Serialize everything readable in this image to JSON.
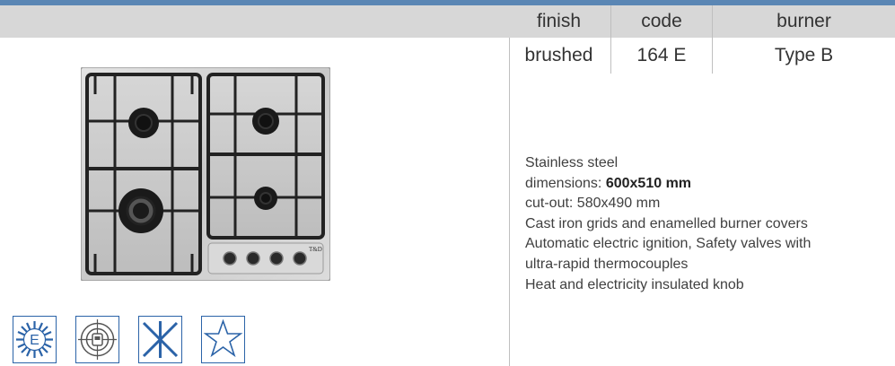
{
  "specs": {
    "headers": [
      "finish",
      "code",
      "burner"
    ],
    "values": [
      "brushed",
      "164 E",
      "Type B"
    ]
  },
  "description": {
    "material": "Stainless steel",
    "dimensions_label": "dimensions: ",
    "dimensions_value": "600x510 mm",
    "cutout": "cut-out: 580x490 mm",
    "grids": "Cast iron grids and enamelled burner covers",
    "ignition_1": "Automatic electric ignition, Safety valves with",
    "ignition_2": "ultra-rapid thermocouples",
    "knob": "Heat and electricity insulated knob"
  },
  "product": {
    "brand_mark": "T&D"
  },
  "energy_icon": {
    "letter": "E"
  },
  "colors": {
    "accent_bar": "#5a86b4",
    "header_band": "#d7d7d7",
    "icon_blue": "#2b63a8"
  }
}
